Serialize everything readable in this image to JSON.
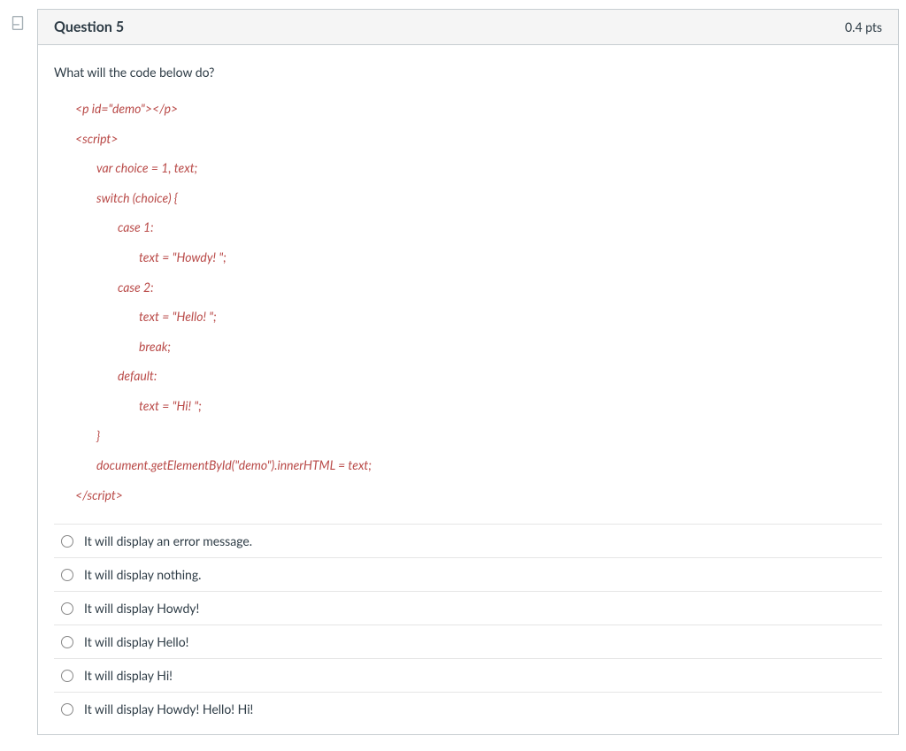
{
  "header": {
    "title": "Question 5",
    "points": "0.4 pts"
  },
  "question": {
    "prompt": "What will the code below do?",
    "code": [
      {
        "text": "<p id=\"demo\"></p>",
        "indent": 1
      },
      {
        "text": "<script>",
        "indent": 1
      },
      {
        "text": "var choice = 1, text;",
        "indent": 2
      },
      {
        "text": "switch (choice) {",
        "indent": 2
      },
      {
        "text": "case 1:",
        "indent": 3
      },
      {
        "text": "text = \"Howdy! \";",
        "indent": 4
      },
      {
        "text": "case 2:",
        "indent": 3
      },
      {
        "text": "text = \"Hello! \";",
        "indent": 4
      },
      {
        "text": "break;",
        "indent": 4
      },
      {
        "text": "default:",
        "indent": 3
      },
      {
        "text": "text = \"Hi! \";",
        "indent": 4
      },
      {
        "text": "}",
        "indent": 2
      },
      {
        "text": "document.getElementById(\"demo\").innerHTML = text;",
        "indent": 2
      },
      {
        "text": "</script>",
        "indent": 1
      }
    ]
  },
  "answers": [
    "It will display an error message.",
    "It will display nothing.",
    "It will display Howdy!",
    "It will display Hello!",
    "It will display Hi!",
    "It will display Howdy! Hello! Hi!"
  ]
}
